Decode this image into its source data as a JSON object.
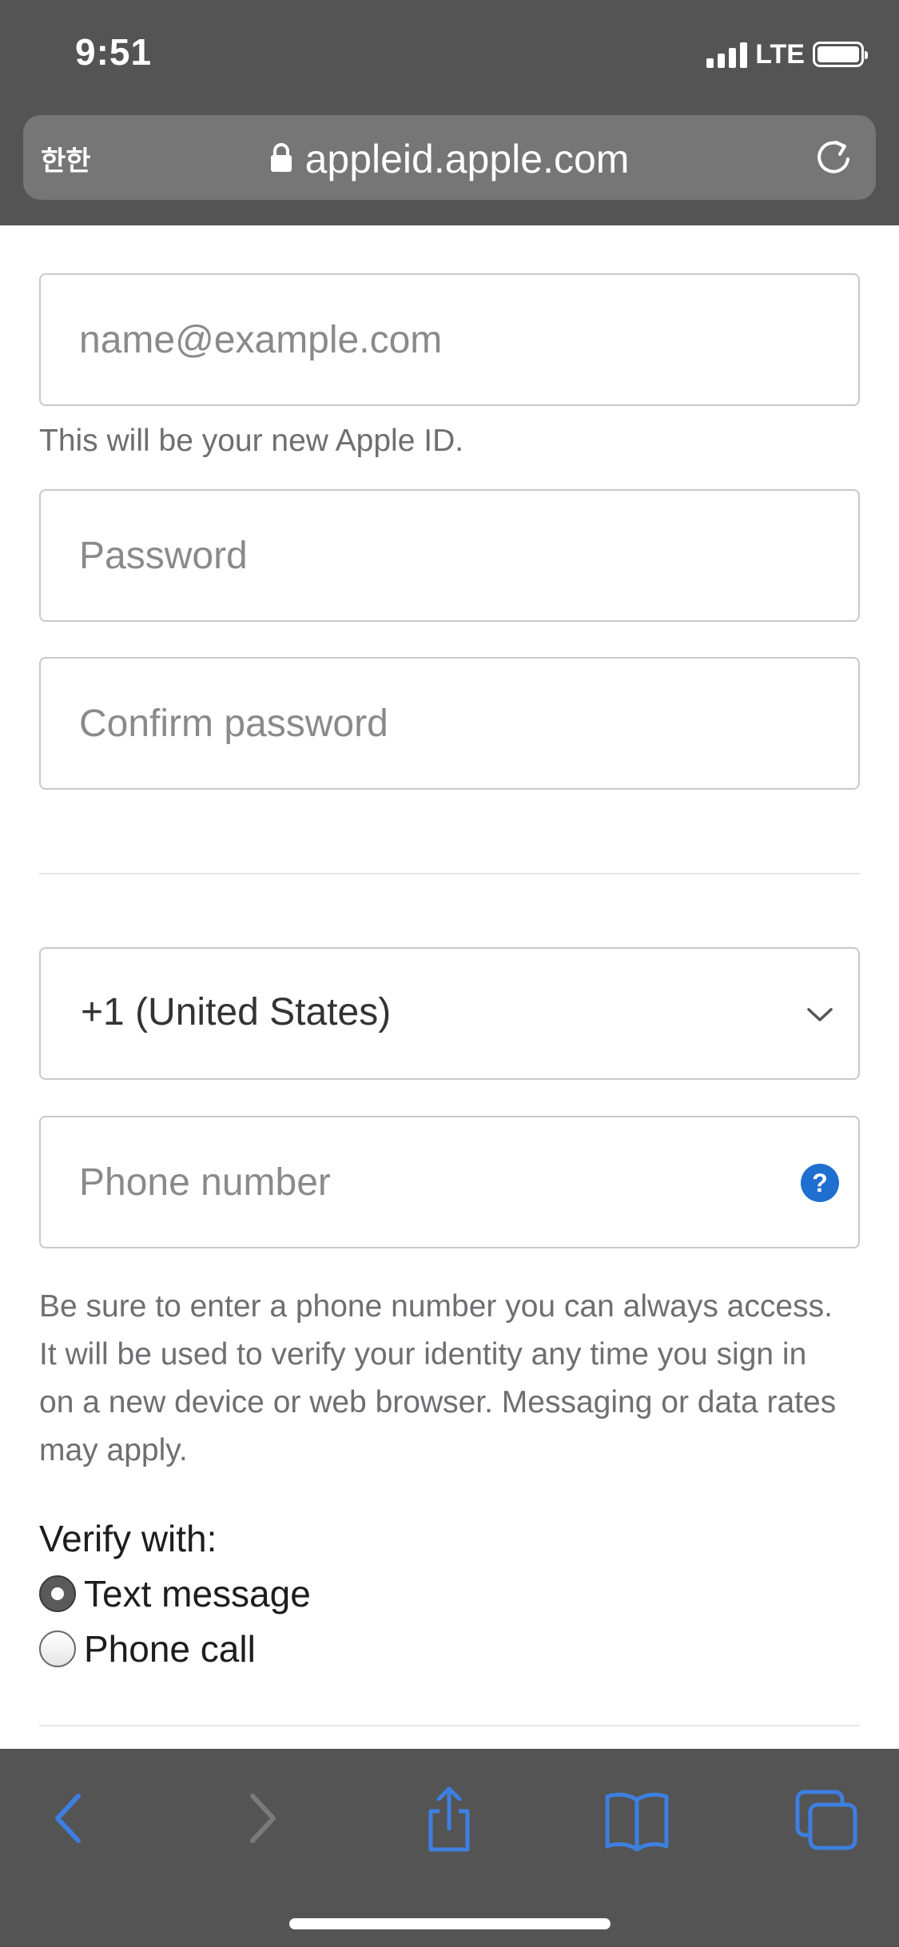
{
  "status_bar": {
    "time": "9:51",
    "network": "LTE"
  },
  "url_bar": {
    "aa_label": "한한",
    "url": "appleid.apple.com"
  },
  "form": {
    "email_placeholder": "name@example.com",
    "email_helper": "This will be your new Apple ID.",
    "password_placeholder": "Password",
    "confirm_password_placeholder": "Confirm password",
    "country_code_selected": "+1 (United States)",
    "phone_placeholder": "Phone number",
    "phone_help_icon": "?",
    "phone_info": "Be sure to enter a phone number you can always access. It will be used to verify your identity any time you sign in on a new device or web browser. Messaging or data rates may apply.",
    "verify_label": "Verify with:",
    "verify_options": [
      {
        "label": "Text message",
        "checked": true
      },
      {
        "label": "Phone call",
        "checked": false
      }
    ]
  },
  "toolbar": {
    "icons": [
      "back-icon",
      "forward-icon",
      "share-icon",
      "bookmarks-icon",
      "tabs-icon"
    ],
    "accent": "#3d7fe0",
    "disabled": "#7a7a7a"
  }
}
